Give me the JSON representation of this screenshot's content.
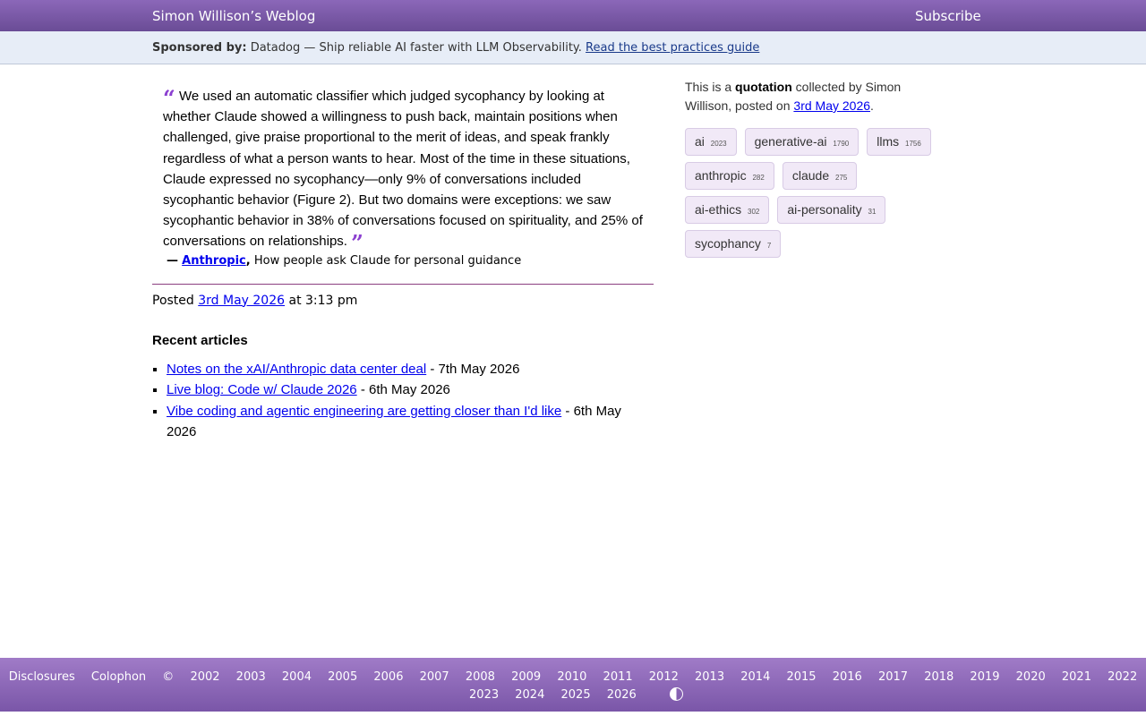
{
  "header": {
    "title": "Simon Willison’s Weblog",
    "subscribe": "Subscribe"
  },
  "sponsor": {
    "label": "Sponsored by:",
    "text": "Datadog — Ship reliable AI faster with LLM Observability.",
    "link": "Read the best practices guide"
  },
  "quote": {
    "text": "We used an automatic classifier which judged sycophancy by looking at whether Claude showed a willingness to push back, maintain positions when challenged, give praise proportional to the merit of ideas, and speak frankly regardless of what a person wants to hear. Most of the time in these situations, Claude expressed no sycophancy—only 9% of conversations included sycophantic behavior (Figure 2). But two domains were exceptions: we saw sycophantic behavior in 38% of conversations focused on spirituality, and 25% of conversations on relationships.",
    "open_mark": "“",
    "close_mark": "”",
    "cite_dash": "—",
    "source": "Anthropic",
    "source_title": "How people ask Claude for personal guidance"
  },
  "posted": {
    "prefix": "Posted",
    "date": "3rd May 2026",
    "time": "at 3:13 pm"
  },
  "recent": {
    "heading": "Recent articles",
    "items": [
      {
        "title": "Notes on the xAI/Anthropic data center deal",
        "date": "- 7th May 2026"
      },
      {
        "title": "Live blog: Code w/ Claude 2026",
        "date": "- 6th May 2026"
      },
      {
        "title": "Vibe coding and agentic engineering are getting closer than I'd like",
        "date": "- 6th May 2026"
      }
    ]
  },
  "sidebar": {
    "about_prefix": "This is a",
    "about_type": "quotation",
    "about_mid": "collected by Simon Willison, posted on",
    "about_date": "3rd May 2026",
    "about_end": ".",
    "tags": [
      {
        "name": "ai",
        "count": "2023"
      },
      {
        "name": "generative-ai",
        "count": "1790"
      },
      {
        "name": "llms",
        "count": "1756"
      },
      {
        "name": "anthropic",
        "count": "282"
      },
      {
        "name": "claude",
        "count": "275"
      },
      {
        "name": "ai-ethics",
        "count": "302"
      },
      {
        "name": "ai-personality",
        "count": "31"
      },
      {
        "name": "sycophancy",
        "count": "7"
      }
    ]
  },
  "footer": {
    "disclosures": "Disclosures",
    "colophon": "Colophon",
    "copyright": "©",
    "years": [
      "2002",
      "2003",
      "2004",
      "2005",
      "2006",
      "2007",
      "2008",
      "2009",
      "2010",
      "2011",
      "2012",
      "2013",
      "2014",
      "2015",
      "2016",
      "2017",
      "2018",
      "2019",
      "2020",
      "2021",
      "2022",
      "2023",
      "2024",
      "2025",
      "2026"
    ],
    "contrast_icon": "contrast-toggle-icon"
  }
}
